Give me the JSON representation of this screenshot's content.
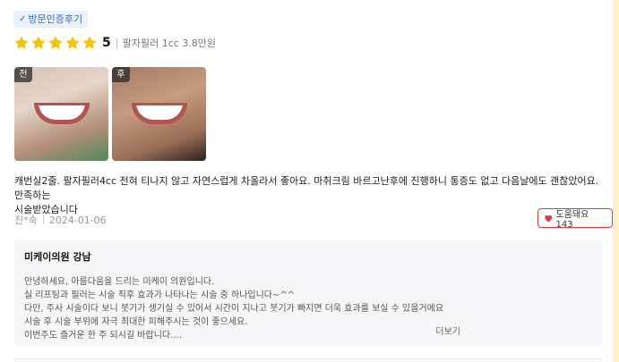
{
  "badge": {
    "label": "방문인증후기"
  },
  "rating": {
    "score": "5",
    "product": "팔자필러 1cc 3.8만원",
    "stars": 5,
    "star_color": "#f5c400"
  },
  "photos": [
    {
      "tag": "전"
    },
    {
      "tag": "후"
    }
  ],
  "review": {
    "text_line1": "캐번실2줄. 팔자필러4cc 전혀 티나지 않고 자연스럽게 차올라서 좋아요. 마취크림 바르고난후에 진행하니 통증도 없고 다음날에도 괜찮았어요. 만족하는",
    "text_line2": "시술받았습니다",
    "author": "진*숙",
    "date": "2024-01-06",
    "helpful_label": "도움돼요 143"
  },
  "reply": {
    "title": "미케이의원 강남",
    "lines": [
      "안녕하세요, 아름다움을 드리는 미케이 의원입니다.",
      "실 리프팅과 필러는 시술 직후 효과가 나타나는 시술 중 하나입니다~^^",
      "다만, 주사 시술이다 보니 붓기가 생기실 수 있어서 시간이 지나고 붓기가 빠지면 더욱 효과를 보실 수 있을거에요",
      "시술 후 시술 부위에 자극 최대한 피해주시는 것이 좋으세요.",
      "이번주도 즐거운 한 주 되시길 바랍니다.…"
    ],
    "more_label": "더보기"
  },
  "colors": {
    "accent_blue": "#2d6fd1",
    "helpful_red": "#e03a3a",
    "background": "#fdf3c6"
  }
}
